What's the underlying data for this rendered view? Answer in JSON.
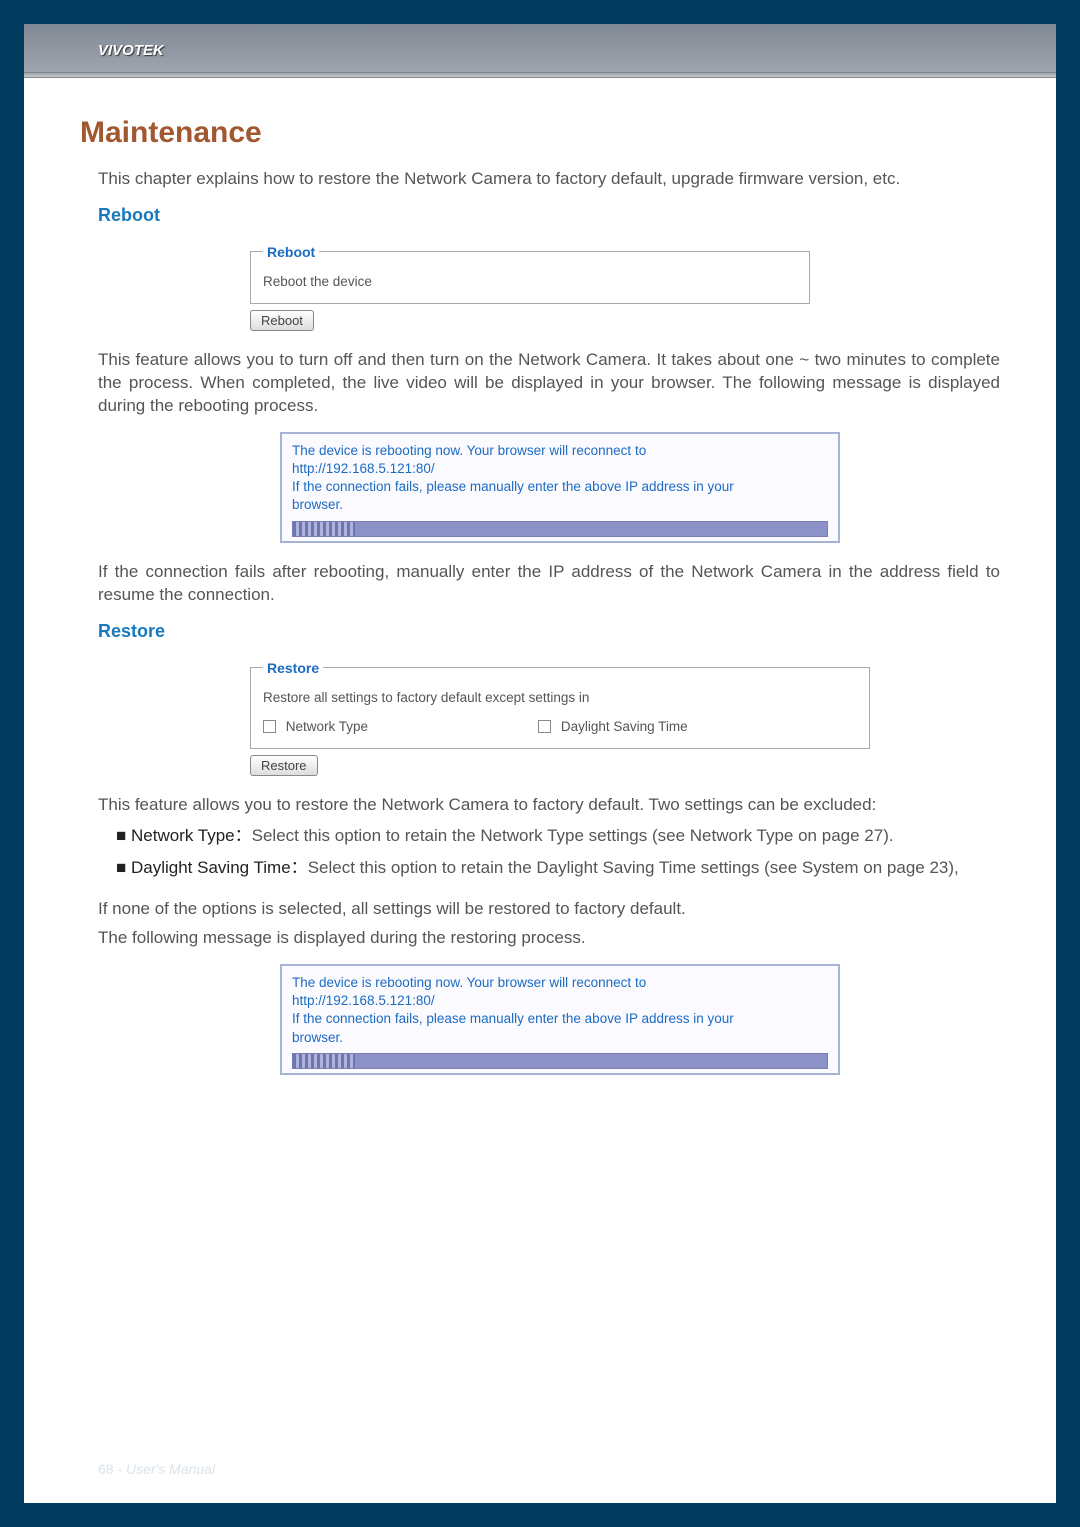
{
  "brand": "VIVOTEK",
  "title": "Maintenance",
  "intro": "This chapter explains how to restore the Network Camera to factory default, upgrade firmware version, etc.",
  "reboot": {
    "heading": "Reboot",
    "fieldset_legend": "Reboot",
    "fieldset_text": "Reboot the device",
    "button": "Reboot",
    "para1": "This feature allows you to turn off and then turn on the Network Camera. It takes about one ~ two minutes to complete the process. When completed, the live video will be displayed in your browser. The following message is displayed during the rebooting process.",
    "msg_line1": "The device is rebooting now. Your browser will reconnect to",
    "msg_line2": "http://192.168.5.121:80/",
    "msg_line3": "If the connection fails, please manually enter the above IP address in your",
    "msg_line4": "browser.",
    "para2": "If the connection fails after rebooting, manually enter the IP address of the Network Camera in the address field to resume the connection."
  },
  "restore": {
    "heading": "Restore",
    "fieldset_legend": "Restore",
    "fieldset_text": "Restore all settings to factory default except settings in",
    "opt1": "Network Type",
    "opt2": "Daylight Saving Time",
    "button": "Restore",
    "para1": "This feature allows you to restore the Network Camera to factory default. Two settings can be excluded:",
    "bullet1_lead": "■ Network Type：",
    "bullet1_text": "Select this option to retain the Network Type settings (see Network Type on page 27).",
    "bullet2_lead": "■ Daylight Saving Time：",
    "bullet2_text": "Select this option to retain the Daylight Saving Time settings (see System on page 23),",
    "para2": "If none of the options is selected, all settings will be restored to factory default.",
    "para3": "The following message is displayed during the restoring process.",
    "msg_line1": "The device is rebooting now. Your browser will reconnect to",
    "msg_line2": "http://192.168.5.121:80/",
    "msg_line3": "If the connection fails, please manually enter the above IP address in your",
    "msg_line4": "browser."
  },
  "footer": {
    "page": "68",
    "sep": " - ",
    "label": "User's Manual"
  }
}
